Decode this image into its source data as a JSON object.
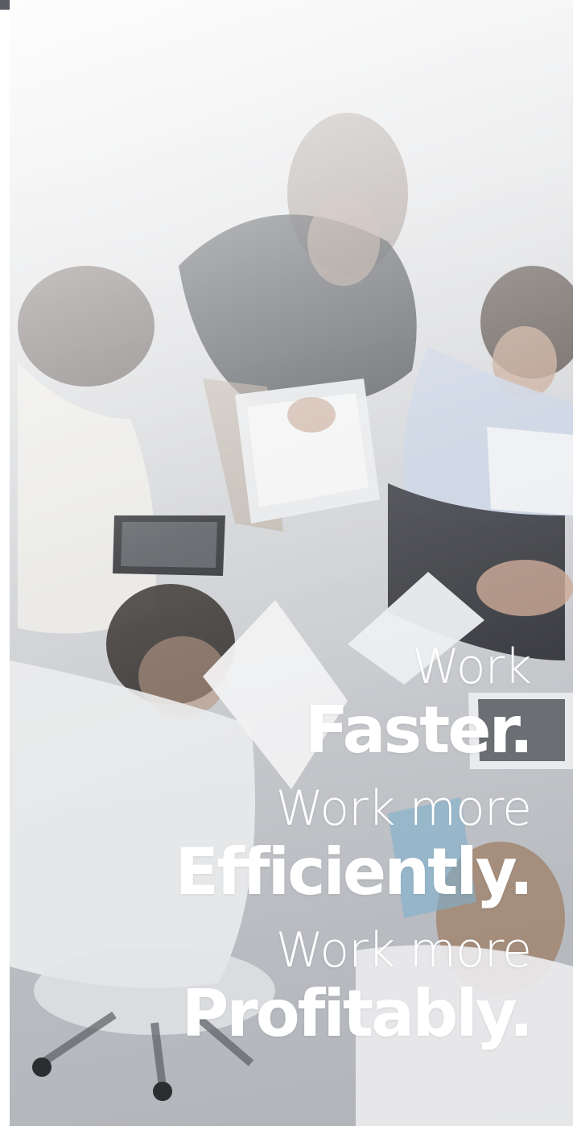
{
  "top_bar_color": "#5a5c62",
  "photo": {
    "subject": "overhead view of business team in meeting"
  },
  "tagline": {
    "line1_light": "Work",
    "line1_bold": "Faster.",
    "line2_light": "Work more",
    "line2_bold": "Efficiently.",
    "line3_light": "Work more",
    "line3_bold": "Profitably."
  },
  "colors": {
    "text": "#ffffff",
    "overlay": "#c5c8cc"
  }
}
